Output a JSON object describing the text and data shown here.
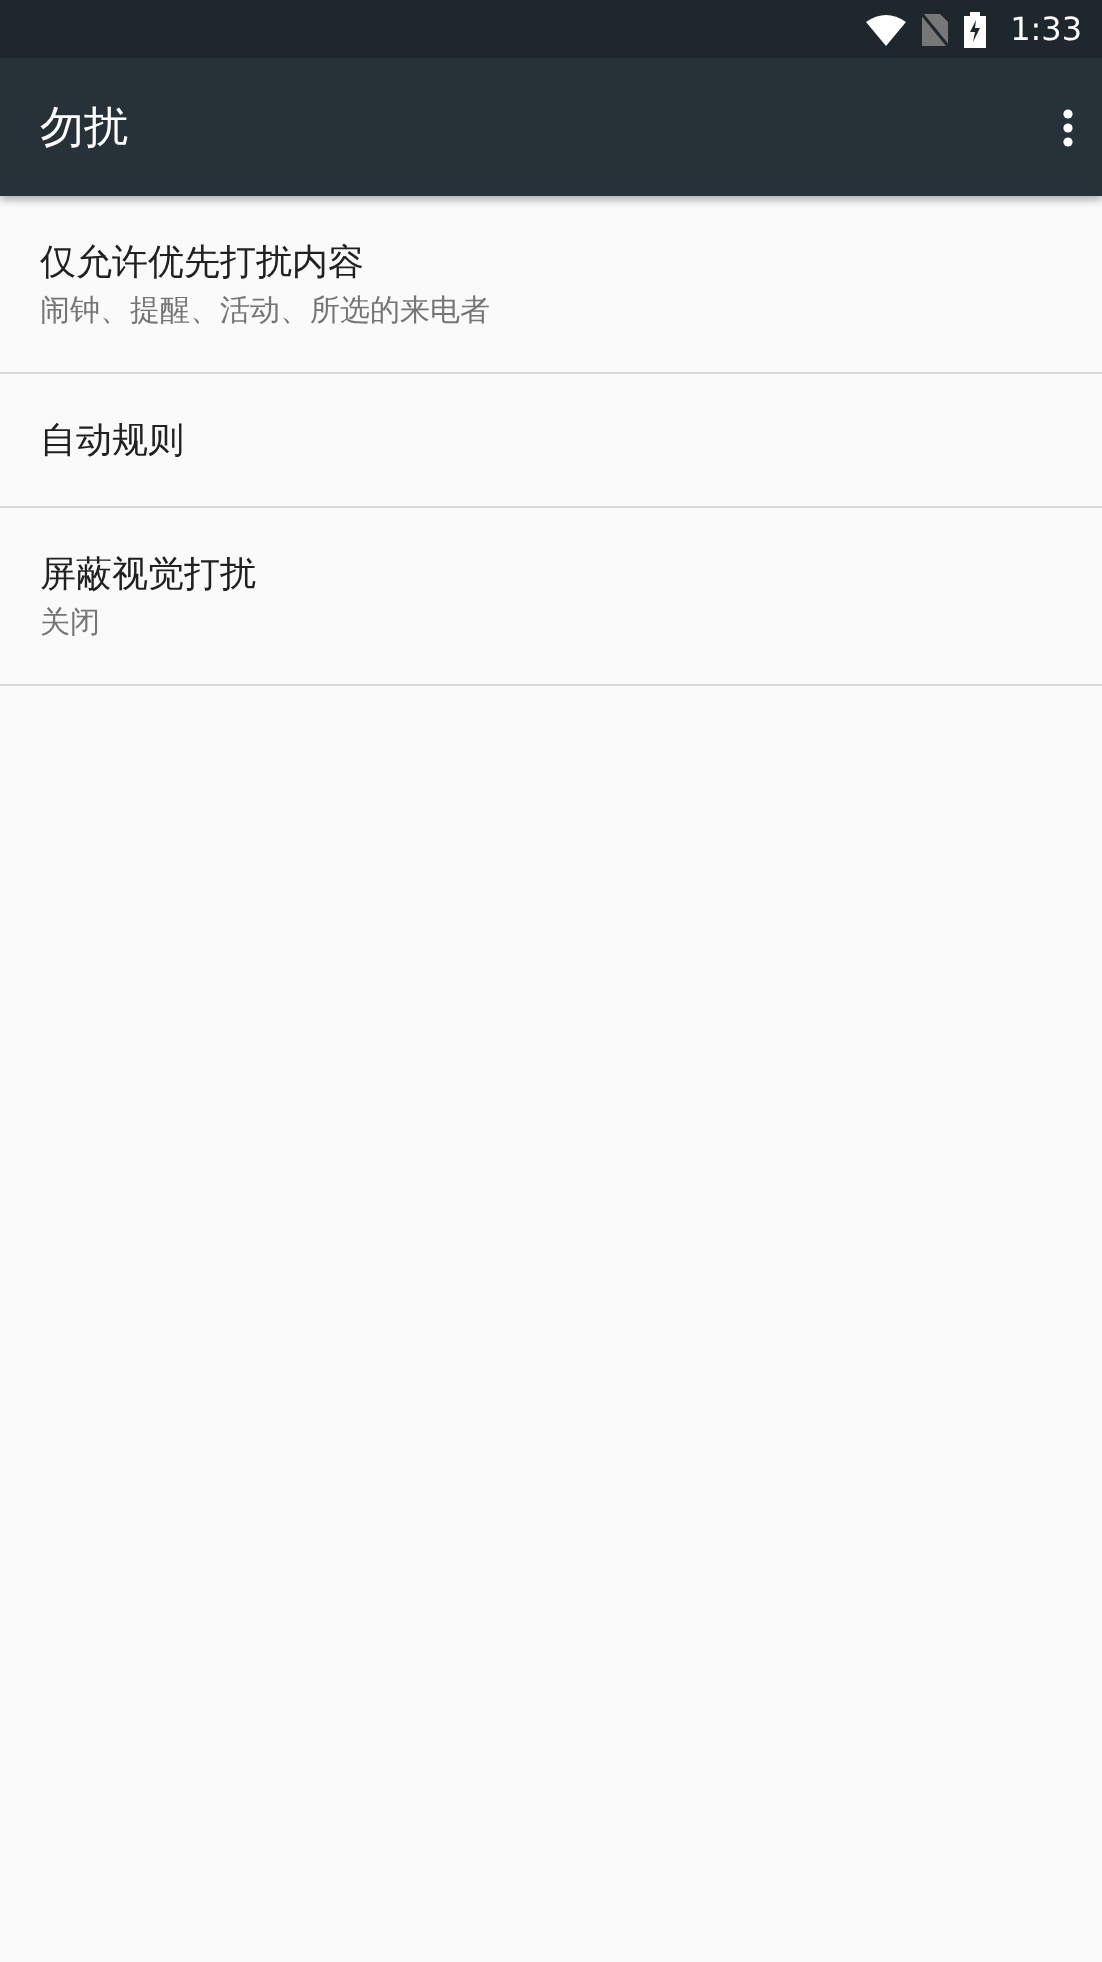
{
  "status_bar": {
    "time": "1:33"
  },
  "app_bar": {
    "title": "勿扰"
  },
  "settings": [
    {
      "title": "仅允许优先打扰内容",
      "summary": "闹钟、提醒、活动、所选的来电者"
    },
    {
      "title": "自动规则"
    },
    {
      "title": "屏蔽视觉打扰",
      "summary": "关闭"
    }
  ]
}
